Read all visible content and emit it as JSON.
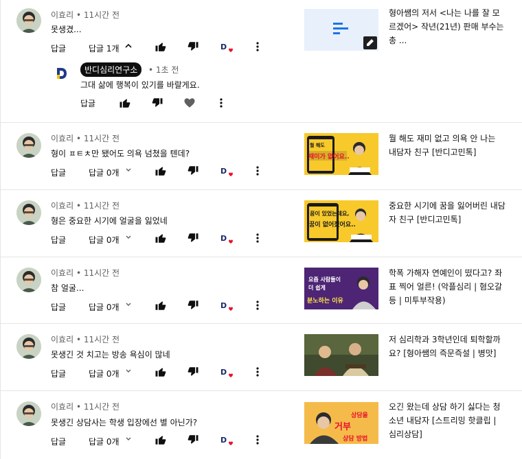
{
  "strings": {
    "reply": "답글"
  },
  "comments": [
    {
      "author": "이효리",
      "time": "11시간 전",
      "text": "못생겼...",
      "replies_label": "답글 1개",
      "expanded": true,
      "reply": {
        "channel": "반디심리연구소",
        "time": "1초 전",
        "text": "그대 삶에 행복이 있기를 바랄게요."
      },
      "video": {
        "title": "형아쌤의 저서 <나는 나를 잘 모르겠어> 작년(21년) 판매 부수는 총 ...",
        "thumb_style": "deleted"
      }
    },
    {
      "author": "이효리",
      "time": "11시간 전",
      "text": "형이 ㅍㅌㅊ만 됐어도 의욕 넘쳤을 텐데?",
      "replies_label": "답글 0개",
      "video": {
        "title": "뭘 해도 재미 없고 의욕 안 나는 내담자 친구 [반디고민톡]",
        "thumb_style": "yellow",
        "thumb_text": "재미가 없어요.."
      }
    },
    {
      "author": "이효리",
      "time": "11시간 전",
      "text": "형은 중요한 시기에 얼굴을 잃었네",
      "replies_label": "답글 0개",
      "video": {
        "title": "중요한 시기에 꿈을 잃어버린 내담자 친구 [반디고민톡]",
        "thumb_style": "yellow",
        "thumb_text": "꿈이 없어졌어요.."
      }
    },
    {
      "author": "이효리",
      "time": "11시간 전",
      "text": "참 얼굴...",
      "replies_label": "답글 0개",
      "video": {
        "title": "학폭 가해자 연예인이 떴다고? 좌표 찍어 얼른! (악플심리 | 혐오갈등 | 미투부작용)",
        "thumb_style": "purple",
        "thumb_text": "분노하는 이유"
      }
    },
    {
      "author": "이효리",
      "time": "11시간 전",
      "text": "못생긴 것 치고는 방송 욕심이 많네",
      "replies_label": "답글 0개",
      "video": {
        "title": "저 심리학과 3학년인데 퇴학할까요? [형아쌤의 즉문즉설 | 병맛]",
        "thumb_style": "photo"
      }
    },
    {
      "author": "이효리",
      "time": "11시간 전",
      "text": "못생긴 상담사는 학생 입장에선 별 아닌가?",
      "replies_label": "답글 0개",
      "video": {
        "title": "오긴 왔는데 상담 하기 싫다는 청소년 내담자 [스트리밍 핫클립 | 심리상담]",
        "thumb_style": "orange",
        "thumb_text": "상담 방법"
      }
    }
  ],
  "colors": {
    "text_primary": "#0f0f0f",
    "text_secondary": "#606060",
    "divider": "#e5e5e5",
    "creator_heart": "#e8112d",
    "badge_bg": "#0f0f0f"
  }
}
